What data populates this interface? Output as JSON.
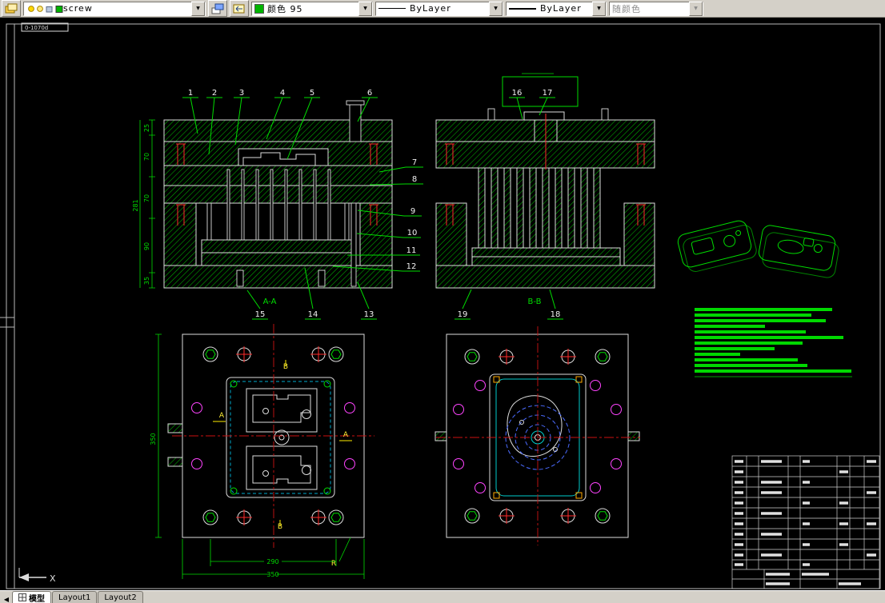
{
  "toolbar": {
    "layer": {
      "value": "screw"
    },
    "color": {
      "value": "颜色 95"
    },
    "linetype": {
      "value": "ByLayer"
    },
    "lineweight": {
      "value": "ByLayer"
    },
    "plotstyle": {
      "value": "随颜色"
    }
  },
  "sheet": {
    "doc_label": "0-1070d"
  },
  "views": {
    "section_aa": {
      "label": "A-A",
      "balloons": [
        "1",
        "2",
        "3",
        "4",
        "5",
        "6",
        "7",
        "8",
        "9",
        "10",
        "11",
        "12",
        "13",
        "14",
        "15"
      ],
      "dims": {
        "d1": "25",
        "d2": "70",
        "d3": "70",
        "d4": "90",
        "d5": "35",
        "total": "281"
      }
    },
    "section_bb": {
      "label": "B-B",
      "balloons": [
        "16",
        "17",
        "18",
        "19"
      ]
    },
    "plan_left": {
      "dims": {
        "height": "350",
        "inner_width": "290",
        "width": "350"
      },
      "markers": {
        "a": "A",
        "b": "B",
        "r": "R"
      }
    }
  },
  "ucs": {
    "axis_x": "X"
  },
  "tabs": {
    "model": "模型",
    "layout1": "Layout1",
    "layout2": "Layout2"
  }
}
